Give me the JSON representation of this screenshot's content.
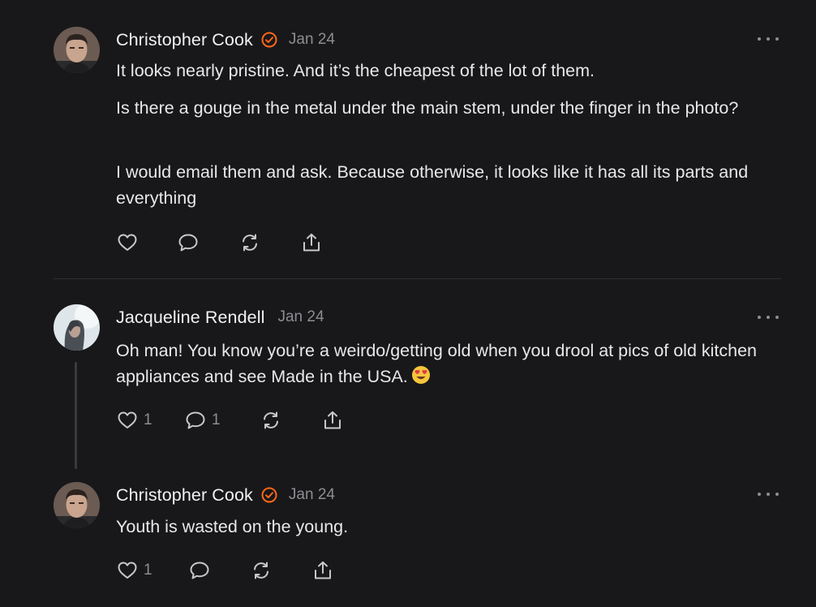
{
  "comments": [
    {
      "author": "Christopher Cook",
      "verified": true,
      "date": "Jan 24",
      "paragraphs": [
        "It looks nearly pristine. And it’s the cheapest of the lot of them.",
        "Is there a gouge in the metal under the main stem, under the finger in the photo?",
        "I would email them and ask. Because otherwise, it looks like it has all its parts and everything"
      ],
      "like_count": "",
      "reply_count": ""
    },
    {
      "author": "Jacqueline Rendell",
      "verified": false,
      "date": "Jan 24",
      "paragraphs": [
        "Oh man! You know you’re a weirdo/getting old when you drool at pics of old kitchen appliances and see Made in the USA."
      ],
      "emoji": "heart-eyes-emoji",
      "like_count": "1",
      "reply_count": "1"
    },
    {
      "author": "Christopher Cook",
      "verified": true,
      "date": "Jan 24",
      "paragraphs": [
        "Youth is wasted on the young."
      ],
      "like_count": "1",
      "reply_count": ""
    }
  ],
  "icons": {
    "like": "heart-icon",
    "reply": "comment-bubble-icon",
    "restack": "restack-icon",
    "share": "share-icon",
    "more": "more-options-icon",
    "verified": "verified-badge-icon"
  },
  "colors": {
    "background": "#18181a",
    "verified_badge": "#ff6719",
    "muted_text": "#8d8d92"
  }
}
